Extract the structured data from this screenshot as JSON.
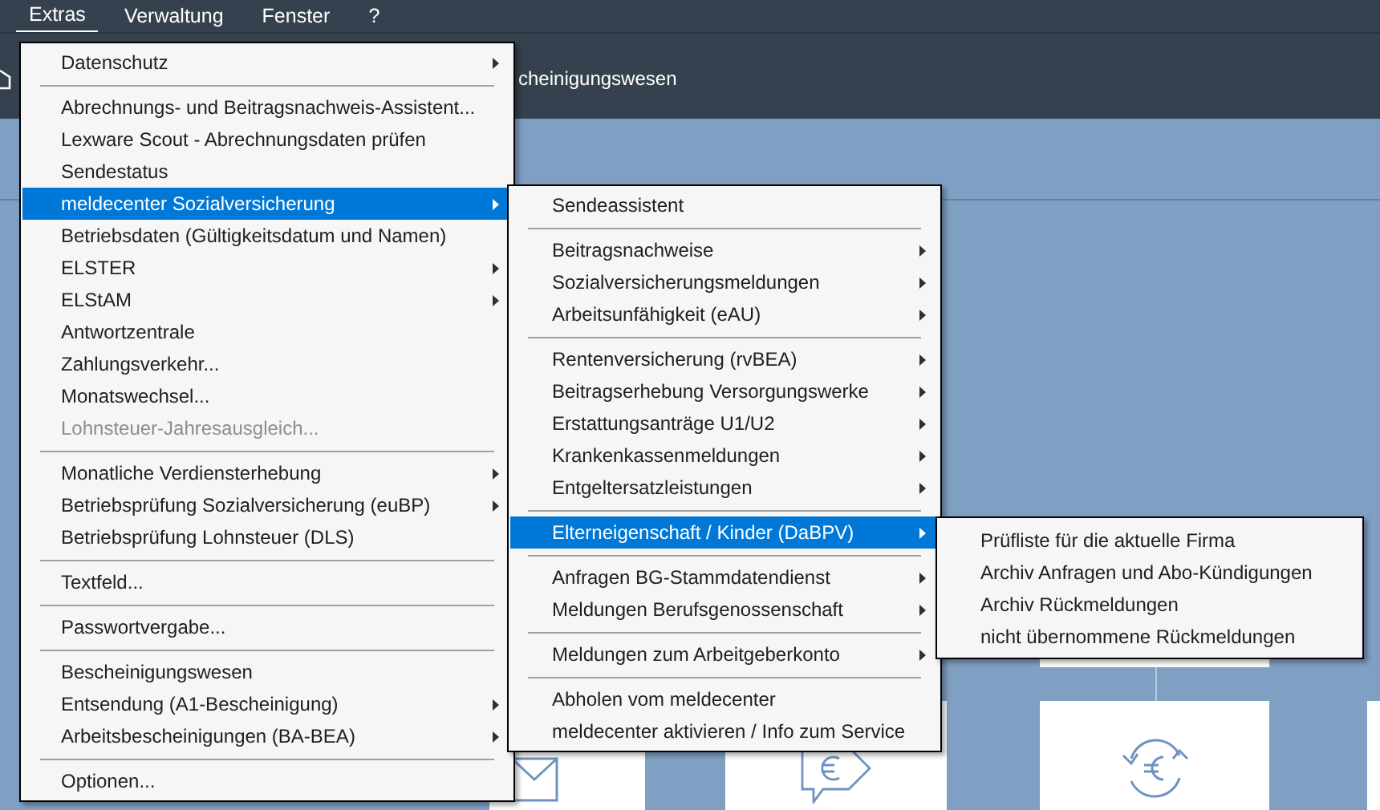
{
  "menubar": [
    {
      "label": "Extras",
      "selected": true
    },
    {
      "label": "Verwaltung",
      "selected": false
    },
    {
      "label": "Fenster",
      "selected": false
    },
    {
      "label": "?",
      "selected": false
    }
  ],
  "header": {
    "title": "cheinigungswesen"
  },
  "extras_menu": [
    {
      "kind": "item",
      "label": "Datenschutz",
      "submenu": true,
      "selected": false,
      "disabled": false
    },
    {
      "kind": "separator"
    },
    {
      "kind": "item",
      "label": "Abrechnungs- und Beitragsnachweis-Assistent...",
      "submenu": false,
      "selected": false,
      "disabled": false
    },
    {
      "kind": "item",
      "label": "Lexware Scout - Abrechnungsdaten prüfen",
      "submenu": false,
      "selected": false,
      "disabled": false
    },
    {
      "kind": "item",
      "label": "Sendestatus",
      "submenu": false,
      "selected": false,
      "disabled": false
    },
    {
      "kind": "item",
      "label": "meldecenter Sozialversicherung",
      "submenu": true,
      "selected": true,
      "disabled": false
    },
    {
      "kind": "item",
      "label": "Betriebsdaten (Gültigkeitsdatum und Namen)",
      "submenu": false,
      "selected": false,
      "disabled": false
    },
    {
      "kind": "item",
      "label": "ELSTER",
      "submenu": true,
      "selected": false,
      "disabled": false
    },
    {
      "kind": "item",
      "label": "ELStAM",
      "submenu": true,
      "selected": false,
      "disabled": false
    },
    {
      "kind": "item",
      "label": "Antwortzentrale",
      "submenu": false,
      "selected": false,
      "disabled": false
    },
    {
      "kind": "item",
      "label": "Zahlungsverkehr...",
      "submenu": false,
      "selected": false,
      "disabled": false
    },
    {
      "kind": "item",
      "label": "Monatswechsel...",
      "submenu": false,
      "selected": false,
      "disabled": false
    },
    {
      "kind": "item",
      "label": "Lohnsteuer-Jahresausgleich...",
      "submenu": false,
      "selected": false,
      "disabled": true
    },
    {
      "kind": "separator"
    },
    {
      "kind": "item",
      "label": "Monatliche Verdiensterhebung",
      "submenu": true,
      "selected": false,
      "disabled": false
    },
    {
      "kind": "item",
      "label": "Betriebsprüfung Sozialversicherung (euBP)",
      "submenu": true,
      "selected": false,
      "disabled": false
    },
    {
      "kind": "item",
      "label": "Betriebsprüfung Lohnsteuer (DLS)",
      "submenu": false,
      "selected": false,
      "disabled": false
    },
    {
      "kind": "separator"
    },
    {
      "kind": "item",
      "label": "Textfeld...",
      "submenu": false,
      "selected": false,
      "disabled": false
    },
    {
      "kind": "separator"
    },
    {
      "kind": "item",
      "label": "Passwortvergabe...",
      "submenu": false,
      "selected": false,
      "disabled": false
    },
    {
      "kind": "separator"
    },
    {
      "kind": "item",
      "label": "Bescheinigungswesen",
      "submenu": false,
      "selected": false,
      "disabled": false
    },
    {
      "kind": "item",
      "label": "Entsendung (A1-Bescheinigung)",
      "submenu": true,
      "selected": false,
      "disabled": false
    },
    {
      "kind": "item",
      "label": "Arbeitsbescheinigungen (BA-BEA)",
      "submenu": true,
      "selected": false,
      "disabled": false
    },
    {
      "kind": "separator"
    },
    {
      "kind": "item",
      "label": "Optionen...",
      "submenu": false,
      "selected": false,
      "disabled": false
    }
  ],
  "meldecenter_menu": [
    {
      "kind": "item",
      "label": "Sendeassistent",
      "submenu": false,
      "selected": false,
      "disabled": false
    },
    {
      "kind": "separator"
    },
    {
      "kind": "item",
      "label": "Beitragsnachweise",
      "submenu": true,
      "selected": false,
      "disabled": false
    },
    {
      "kind": "item",
      "label": "Sozialversicherungsmeldungen",
      "submenu": true,
      "selected": false,
      "disabled": false
    },
    {
      "kind": "item",
      "label": "Arbeitsunfähigkeit (eAU)",
      "submenu": true,
      "selected": false,
      "disabled": false
    },
    {
      "kind": "separator"
    },
    {
      "kind": "item",
      "label": "Rentenversicherung (rvBEA)",
      "submenu": true,
      "selected": false,
      "disabled": false
    },
    {
      "kind": "item",
      "label": "Beitragserhebung Versorgungswerke",
      "submenu": true,
      "selected": false,
      "disabled": false
    },
    {
      "kind": "item",
      "label": "Erstattungsanträge U1/U2",
      "submenu": true,
      "selected": false,
      "disabled": false
    },
    {
      "kind": "item",
      "label": "Krankenkassenmeldungen",
      "submenu": true,
      "selected": false,
      "disabled": false
    },
    {
      "kind": "item",
      "label": "Entgeltersatzleistungen",
      "submenu": true,
      "selected": false,
      "disabled": false
    },
    {
      "kind": "separator"
    },
    {
      "kind": "item",
      "label": "Elterneigenschaft / Kinder (DaBPV)",
      "submenu": true,
      "selected": true,
      "disabled": false
    },
    {
      "kind": "separator"
    },
    {
      "kind": "item",
      "label": "Anfragen BG-Stammdatendienst",
      "submenu": true,
      "selected": false,
      "disabled": false
    },
    {
      "kind": "item",
      "label": "Meldungen Berufsgenossenschaft",
      "submenu": true,
      "selected": false,
      "disabled": false
    },
    {
      "kind": "separator"
    },
    {
      "kind": "item",
      "label": "Meldungen zum Arbeitgeberkonto",
      "submenu": true,
      "selected": false,
      "disabled": false
    },
    {
      "kind": "separator"
    },
    {
      "kind": "item",
      "label": "Abholen vom meldecenter",
      "submenu": false,
      "selected": false,
      "disabled": false
    },
    {
      "kind": "item",
      "label": "meldecenter aktivieren / Info zum Service",
      "submenu": false,
      "selected": false,
      "disabled": false
    }
  ],
  "dabpv_menu": [
    {
      "kind": "item",
      "label": "Prüfliste für die aktuelle Firma",
      "submenu": false,
      "selected": false,
      "disabled": false
    },
    {
      "kind": "item",
      "label": "Archiv Anfragen und Abo-Kündigungen",
      "submenu": false,
      "selected": false,
      "disabled": false
    },
    {
      "kind": "item",
      "label": "Archiv Rückmeldungen",
      "submenu": false,
      "selected": false,
      "disabled": false
    },
    {
      "kind": "item",
      "label": "nicht übernommene Rückmeldungen",
      "submenu": false,
      "selected": false,
      "disabled": false
    }
  ]
}
